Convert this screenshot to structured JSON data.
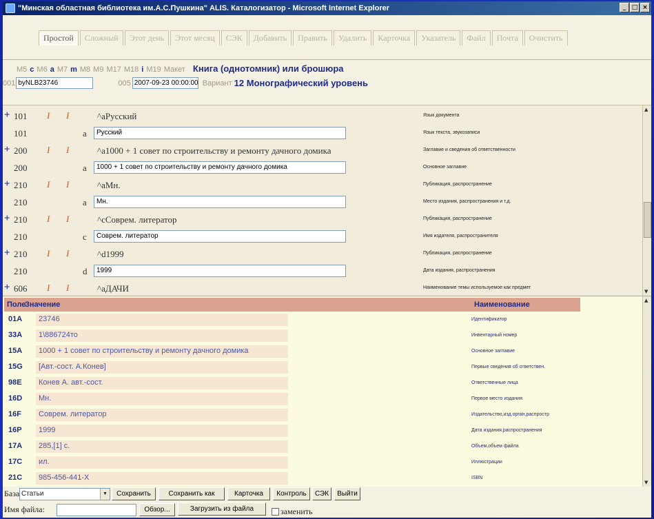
{
  "window": {
    "title": "\"Минская областная библиотека им.А.С.Пушкина\" ALIS. Каталогизатор - Microsoft Internet Explorer",
    "controls": [
      "_",
      "□",
      "×"
    ]
  },
  "tabs": [
    "Простой",
    "Сложный",
    "Этот день",
    "Этот месяц",
    "СЭК",
    "Добавить",
    "Править",
    "Удалить",
    "Карточка",
    "Указатель",
    "Файл",
    "Почта",
    "Очистить"
  ],
  "markers": [
    {
      "label": "M5",
      "style": "gray"
    },
    {
      "label": "c",
      "style": "blue"
    },
    {
      "label": "M6",
      "style": "gray"
    },
    {
      "label": "a",
      "style": "blue"
    },
    {
      "label": "M7",
      "style": "gray"
    },
    {
      "label": "m",
      "style": "blue"
    },
    {
      "label": "M8",
      "style": "gray"
    },
    {
      "label": "M9",
      "style": "gray"
    },
    {
      "label": "M17",
      "style": "gray"
    },
    {
      "label": "M18",
      "style": "gray"
    },
    {
      "label": "i",
      "style": "blue"
    },
    {
      "label": "M19",
      "style": "gray"
    },
    {
      "label": "Макет",
      "style": "gray"
    }
  ],
  "maket_value": "Книга (однотомник) или брошюра",
  "record": {
    "f001_label": "001",
    "f001_value": "byNLB23746",
    "f005_label": "005",
    "f005_value": "2007-09-23 00:00:00",
    "variant_label": "Вариант",
    "variant_value": "12 Монографический уровень"
  },
  "upper_rows": [
    {
      "plus": "+",
      "tag": "101",
      "ind1": "I",
      "ind2": "I",
      "raw": "^aРусский",
      "desc": "Язык документа"
    },
    {
      "tag": "101",
      "code": "a",
      "value": "Русский",
      "desc": "Язык текста, звукозаписи"
    },
    {
      "plus": "+",
      "tag": "200",
      "ind1": "I",
      "ind2": "I",
      "raw": "^a1000 + 1 совет по строительству и ремонту дачного домика",
      "desc": "Заглавие и сведения об ответственности"
    },
    {
      "tag": "200",
      "code": "a",
      "value": "1000 + 1 совет по строительству и ремонту дачного домика",
      "desc": "Основное заглавие"
    },
    {
      "plus": "+",
      "tag": "210",
      "ind1": "I",
      "ind2": "I",
      "raw": "^aМн.",
      "desc": "Публикация, распространение"
    },
    {
      "tag": "210",
      "code": "a",
      "value": "Мн.",
      "desc": "Место издания, распространения и т.д."
    },
    {
      "plus": "+",
      "tag": "210",
      "ind1": "I",
      "ind2": "I",
      "raw": "^cСоврем. литератор",
      "desc": "Публикация, распространение"
    },
    {
      "tag": "210",
      "code": "c",
      "value": "Соврем. литератор",
      "desc": "Имя издателя, распространителя"
    },
    {
      "plus": "+",
      "tag": "210",
      "ind1": "I",
      "ind2": "I",
      "raw": "^d1999",
      "desc": "Публикация, распространение"
    },
    {
      "tag": "210",
      "code": "d",
      "value": "1999",
      "desc": "Дата издания, распространения"
    },
    {
      "plus": "+",
      "tag": "606",
      "ind1": "I",
      "ind2": "I",
      "raw": "^aДАЧИ",
      "desc": "Наименование темы используемое как предмет"
    }
  ],
  "lower_header": {
    "col1": "Поле",
    "col2": "Значение",
    "col3": "Наименование"
  },
  "lower_rows": [
    {
      "field": "01A",
      "value": "23746",
      "name": "Идентификатор"
    },
    {
      "field": "33A",
      "value": "1\\886724то",
      "name": "Инвентарный номер"
    },
    {
      "field": "15A",
      "value": "1000 + 1 совет по строительству и ремонту дачного домика",
      "name": "Основное заглавие"
    },
    {
      "field": "15G",
      "value": "[Авт.-сост. А.Конев]",
      "name": "Первые сведения об ответствен."
    },
    {
      "field": "98E",
      "value": "Конев А. авт.-сост.",
      "name": "Ответственные лица"
    },
    {
      "field": "16D",
      "value": "Мн.",
      "name": "Первое место издания"
    },
    {
      "field": "16F",
      "value": "Соврем. литератор",
      "name": "Издательство,изд.орган,распростр"
    },
    {
      "field": "16P",
      "value": "1999",
      "name": "Дата издания,распространения"
    },
    {
      "field": "17A",
      "value": "285,[1] с.",
      "name": "Объем,объем файла"
    },
    {
      "field": "17C",
      "value": "ил.",
      "name": "Иллюстрации"
    },
    {
      "field": "21C",
      "value": "985-456-441-X",
      "name": "ISBN"
    }
  ],
  "bottom": {
    "base_label": "База",
    "base_value": "Статьи",
    "save": "Сохранить",
    "save_as": "Сохранить как",
    "card": "Карточка",
    "control": "Контроль",
    "sek": "СЭК",
    "exit": "Выйти",
    "filename_label": "Имя файла:",
    "filename_value": "",
    "browse": "Обзор...",
    "load": "Загрузить из файла",
    "replace": "заменить"
  }
}
